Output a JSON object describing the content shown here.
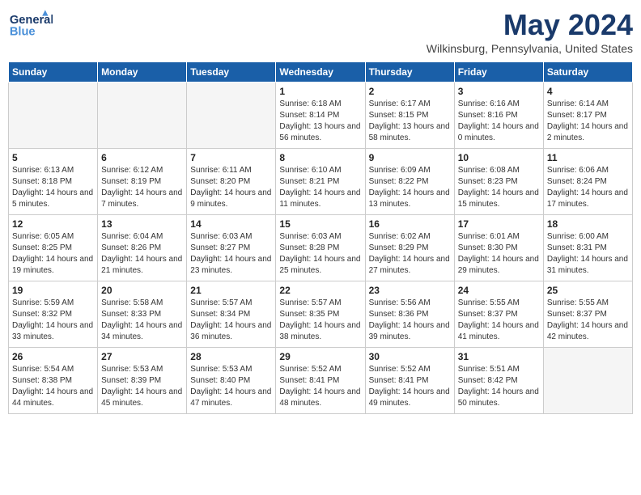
{
  "header": {
    "logo_line1": "General",
    "logo_line2": "Blue",
    "month": "May 2024",
    "location": "Wilkinsburg, Pennsylvania, United States"
  },
  "days_of_week": [
    "Sunday",
    "Monday",
    "Tuesday",
    "Wednesday",
    "Thursday",
    "Friday",
    "Saturday"
  ],
  "weeks": [
    [
      {
        "day": "",
        "empty": true
      },
      {
        "day": "",
        "empty": true
      },
      {
        "day": "",
        "empty": true
      },
      {
        "day": "1",
        "sunrise": "6:18 AM",
        "sunset": "8:14 PM",
        "daylight": "13 hours and 56 minutes."
      },
      {
        "day": "2",
        "sunrise": "6:17 AM",
        "sunset": "8:15 PM",
        "daylight": "13 hours and 58 minutes."
      },
      {
        "day": "3",
        "sunrise": "6:16 AM",
        "sunset": "8:16 PM",
        "daylight": "14 hours and 0 minutes."
      },
      {
        "day": "4",
        "sunrise": "6:14 AM",
        "sunset": "8:17 PM",
        "daylight": "14 hours and 2 minutes."
      }
    ],
    [
      {
        "day": "5",
        "sunrise": "6:13 AM",
        "sunset": "8:18 PM",
        "daylight": "14 hours and 5 minutes."
      },
      {
        "day": "6",
        "sunrise": "6:12 AM",
        "sunset": "8:19 PM",
        "daylight": "14 hours and 7 minutes."
      },
      {
        "day": "7",
        "sunrise": "6:11 AM",
        "sunset": "8:20 PM",
        "daylight": "14 hours and 9 minutes."
      },
      {
        "day": "8",
        "sunrise": "6:10 AM",
        "sunset": "8:21 PM",
        "daylight": "14 hours and 11 minutes."
      },
      {
        "day": "9",
        "sunrise": "6:09 AM",
        "sunset": "8:22 PM",
        "daylight": "14 hours and 13 minutes."
      },
      {
        "day": "10",
        "sunrise": "6:08 AM",
        "sunset": "8:23 PM",
        "daylight": "14 hours and 15 minutes."
      },
      {
        "day": "11",
        "sunrise": "6:06 AM",
        "sunset": "8:24 PM",
        "daylight": "14 hours and 17 minutes."
      }
    ],
    [
      {
        "day": "12",
        "sunrise": "6:05 AM",
        "sunset": "8:25 PM",
        "daylight": "14 hours and 19 minutes."
      },
      {
        "day": "13",
        "sunrise": "6:04 AM",
        "sunset": "8:26 PM",
        "daylight": "14 hours and 21 minutes."
      },
      {
        "day": "14",
        "sunrise": "6:03 AM",
        "sunset": "8:27 PM",
        "daylight": "14 hours and 23 minutes."
      },
      {
        "day": "15",
        "sunrise": "6:03 AM",
        "sunset": "8:28 PM",
        "daylight": "14 hours and 25 minutes."
      },
      {
        "day": "16",
        "sunrise": "6:02 AM",
        "sunset": "8:29 PM",
        "daylight": "14 hours and 27 minutes."
      },
      {
        "day": "17",
        "sunrise": "6:01 AM",
        "sunset": "8:30 PM",
        "daylight": "14 hours and 29 minutes."
      },
      {
        "day": "18",
        "sunrise": "6:00 AM",
        "sunset": "8:31 PM",
        "daylight": "14 hours and 31 minutes."
      }
    ],
    [
      {
        "day": "19",
        "sunrise": "5:59 AM",
        "sunset": "8:32 PM",
        "daylight": "14 hours and 33 minutes."
      },
      {
        "day": "20",
        "sunrise": "5:58 AM",
        "sunset": "8:33 PM",
        "daylight": "14 hours and 34 minutes."
      },
      {
        "day": "21",
        "sunrise": "5:57 AM",
        "sunset": "8:34 PM",
        "daylight": "14 hours and 36 minutes."
      },
      {
        "day": "22",
        "sunrise": "5:57 AM",
        "sunset": "8:35 PM",
        "daylight": "14 hours and 38 minutes."
      },
      {
        "day": "23",
        "sunrise": "5:56 AM",
        "sunset": "8:36 PM",
        "daylight": "14 hours and 39 minutes."
      },
      {
        "day": "24",
        "sunrise": "5:55 AM",
        "sunset": "8:37 PM",
        "daylight": "14 hours and 41 minutes."
      },
      {
        "day": "25",
        "sunrise": "5:55 AM",
        "sunset": "8:37 PM",
        "daylight": "14 hours and 42 minutes."
      }
    ],
    [
      {
        "day": "26",
        "sunrise": "5:54 AM",
        "sunset": "8:38 PM",
        "daylight": "14 hours and 44 minutes."
      },
      {
        "day": "27",
        "sunrise": "5:53 AM",
        "sunset": "8:39 PM",
        "daylight": "14 hours and 45 minutes."
      },
      {
        "day": "28",
        "sunrise": "5:53 AM",
        "sunset": "8:40 PM",
        "daylight": "14 hours and 47 minutes."
      },
      {
        "day": "29",
        "sunrise": "5:52 AM",
        "sunset": "8:41 PM",
        "daylight": "14 hours and 48 minutes."
      },
      {
        "day": "30",
        "sunrise": "5:52 AM",
        "sunset": "8:41 PM",
        "daylight": "14 hours and 49 minutes."
      },
      {
        "day": "31",
        "sunrise": "5:51 AM",
        "sunset": "8:42 PM",
        "daylight": "14 hours and 50 minutes."
      },
      {
        "day": "",
        "empty": true
      }
    ]
  ],
  "labels": {
    "sunrise": "Sunrise:",
    "sunset": "Sunset:",
    "daylight": "Daylight:"
  }
}
